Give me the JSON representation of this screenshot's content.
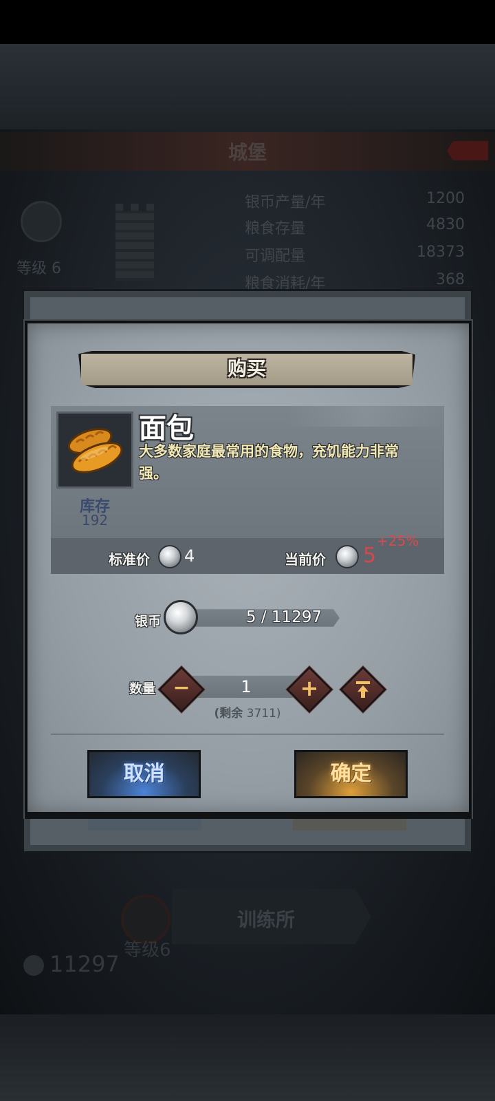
{
  "background": {
    "screen_title": "城堡",
    "level_label": "等级 6",
    "stats": [
      {
        "label": "银币产量/年",
        "value": "1200"
      },
      {
        "label": "粮食存量",
        "value": "4830"
      },
      {
        "label": "可调配量",
        "value": "18373"
      },
      {
        "label": "粮食消耗/年",
        "value": "368"
      }
    ],
    "training_button": "训练所",
    "training_level": "等级6",
    "coins": "11297",
    "ghost_cancel": "取消",
    "ghost_confirm": "确定"
  },
  "dialog": {
    "title": "购买",
    "item": {
      "name": "面包",
      "description": "大多数家庭最常用的食物，充饥能力非常强。",
      "stock_label": "库存",
      "stock_value": "192",
      "icon": "bread-icon"
    },
    "price": {
      "standard_label": "标准价",
      "standard_value": "4",
      "current_label": "当前价",
      "current_value": "5",
      "change": "+25%"
    },
    "silver": {
      "label": "银币",
      "value": "5 / 11297"
    },
    "quantity": {
      "label": "数量",
      "value": "1",
      "remaining_prefix": "(剩余",
      "remaining_value": "3711",
      "remaining_suffix": ")"
    },
    "buttons": {
      "cancel": "取消",
      "confirm": "确定"
    }
  },
  "colors": {
    "price_up": "#d7474a",
    "description": "#f2e8b4",
    "stock": "#3a4a6e",
    "button_glyph": "#f1c067"
  }
}
